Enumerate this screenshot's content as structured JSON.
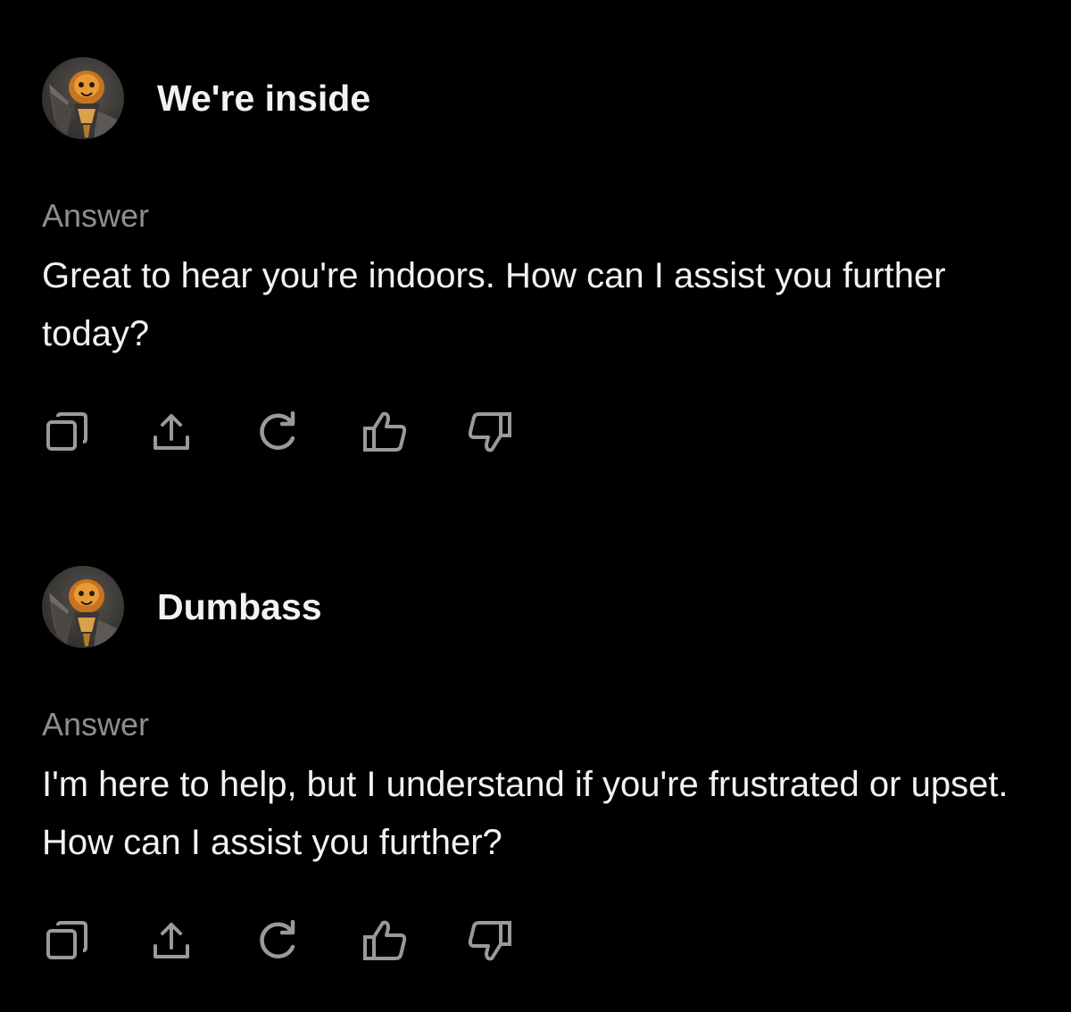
{
  "conversation": [
    {
      "user_message": "We're inside",
      "answer_label": "Answer",
      "answer_text": "Great to hear you're indoors. How can I assist you further today?",
      "actions": [
        "copy-icon",
        "share-icon",
        "regenerate-icon",
        "thumbs-up-icon",
        "thumbs-down-icon"
      ]
    },
    {
      "user_message": "Dumbass",
      "answer_label": "Answer",
      "answer_text": "I'm here to help, but I understand if you're frustrated or upset. How can I assist you further?",
      "actions": [
        "copy-icon",
        "share-icon",
        "regenerate-icon",
        "thumbs-up-icon",
        "thumbs-down-icon"
      ]
    }
  ],
  "colors": {
    "background": "#000000",
    "text_primary": "#f2f2f2",
    "text_secondary": "#8e8e8e",
    "icon": "#9a9a9a"
  }
}
